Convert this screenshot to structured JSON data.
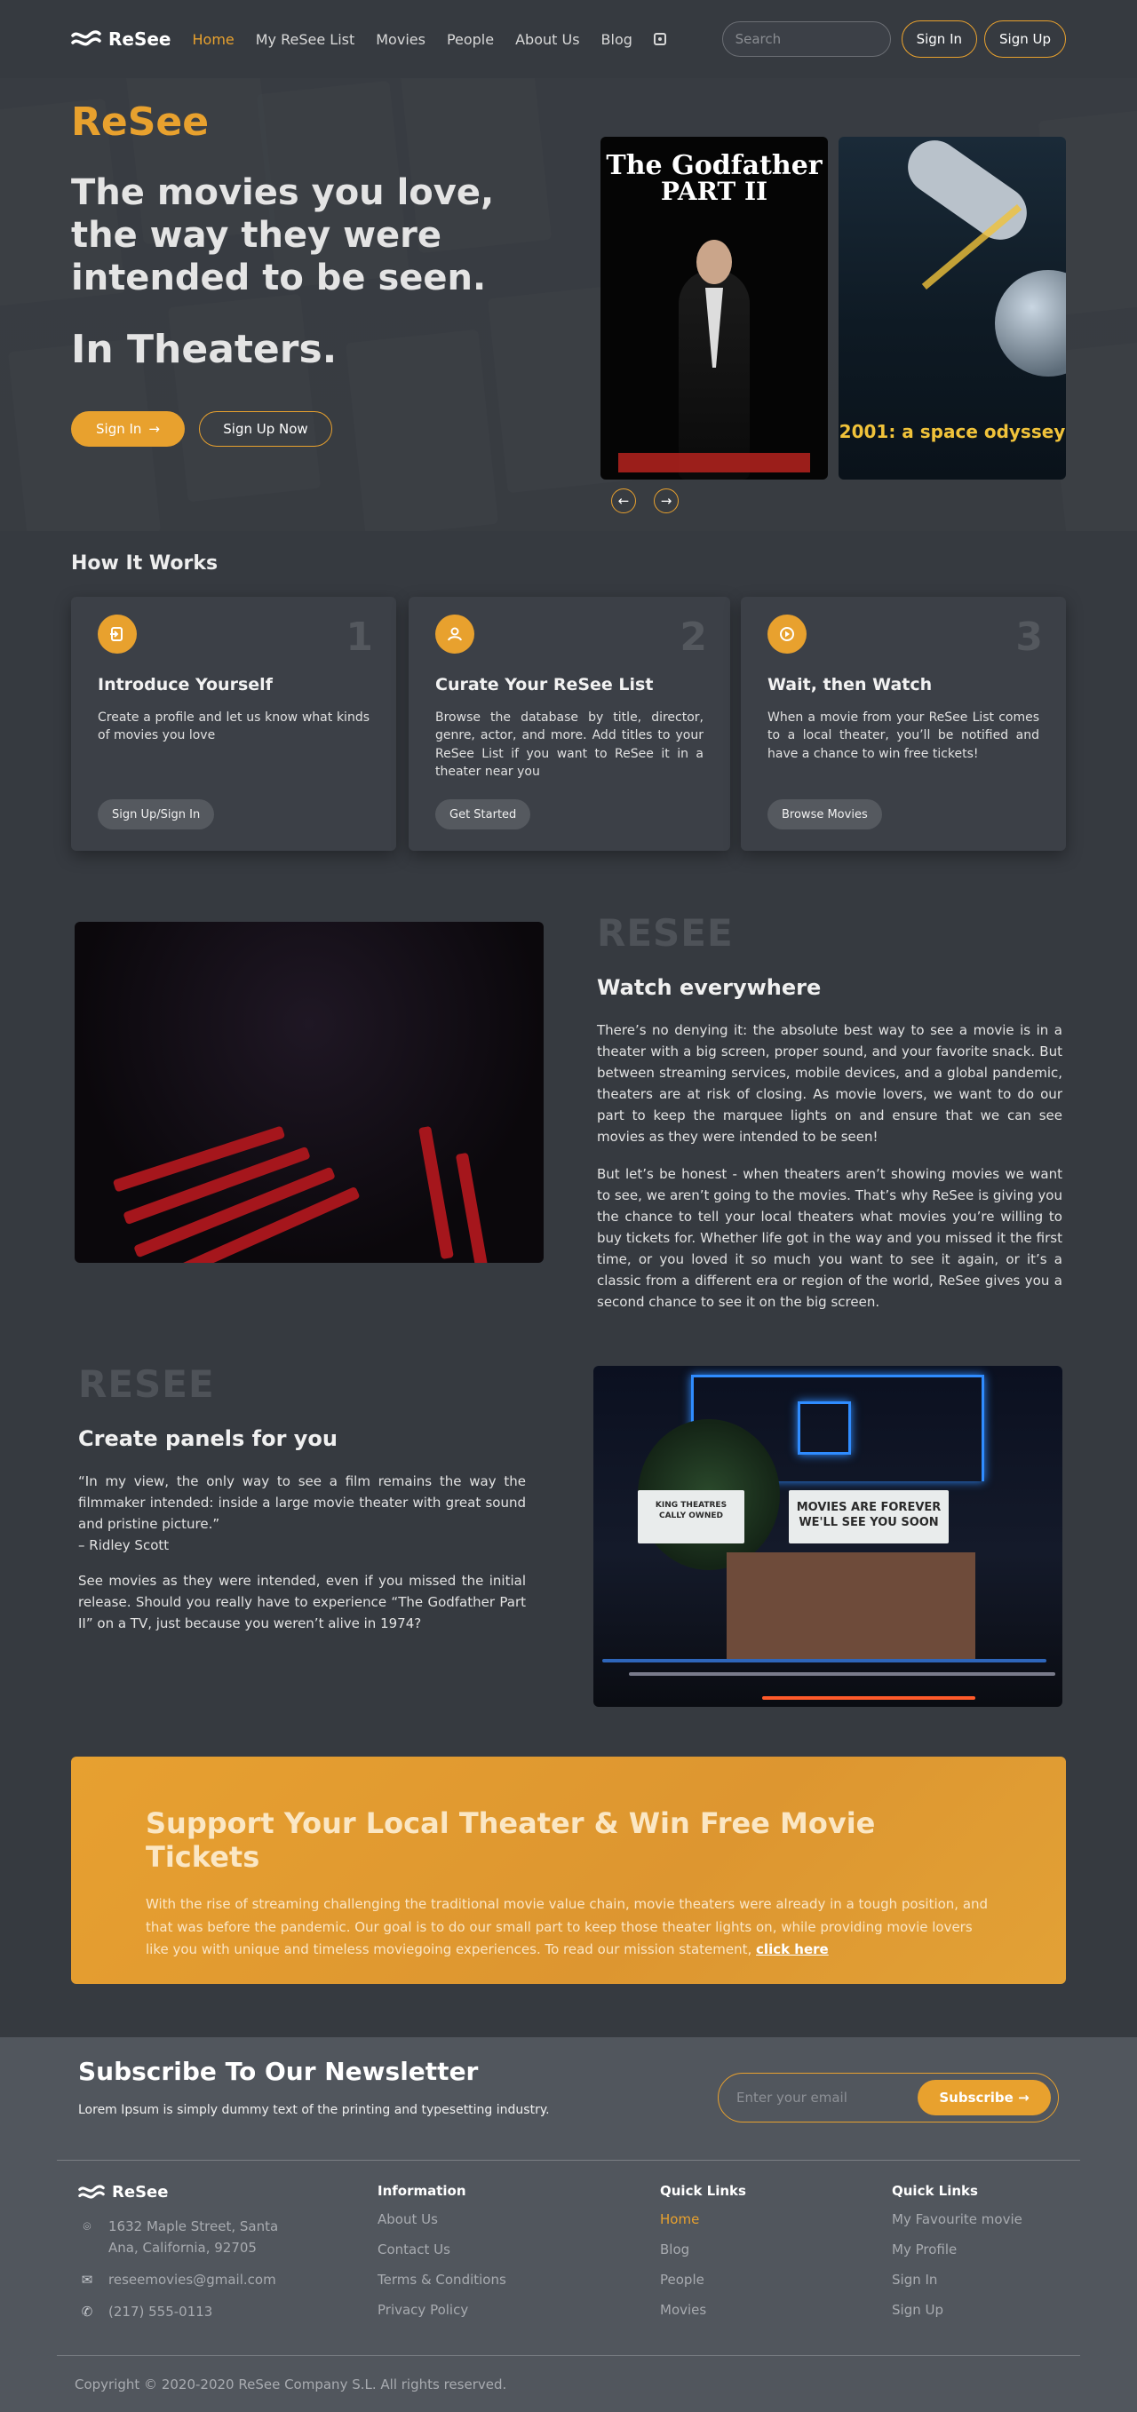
{
  "header": {
    "brand": "ReSee",
    "nav": [
      "Home",
      "My ReSee List",
      "Movies",
      "People",
      "About Us",
      "Blog"
    ],
    "search_placeholder": "Search",
    "sign_in": "Sign In",
    "sign_up": "Sign Up"
  },
  "hero": {
    "brand": "ReSee",
    "title": "The movies you love, the way they were intended to be seen.",
    "subtitle": "In Theaters.",
    "sign_in": "Sign In",
    "sign_up_now": "Sign Up Now",
    "poster1": {
      "title": "The Godfather",
      "subtitle": "PART II"
    },
    "poster2": {
      "title": "2001: a space odyssey"
    }
  },
  "how_it_works": {
    "title": "How It Works",
    "cards": [
      {
        "num": "1",
        "title": "Introduce Yourself",
        "text": "Create a profile and let us know what kinds of movies you love",
        "button": "Sign Up/Sign In"
      },
      {
        "num": "2",
        "title": "Curate Your ReSee List",
        "text": "Browse the database by title, director, genre, actor, and more. Add titles to your ReSee List if you want to ReSee it in a theater near you",
        "button": "Get Started"
      },
      {
        "num": "3",
        "title": "Wait, then Watch",
        "text": "When a movie from your ReSee List comes to a local theater, you’ll be notified and have a chance to win free tickets!",
        "button": "Browse Movies"
      }
    ]
  },
  "watch": {
    "watermark": "RESEE",
    "title": "Watch everywhere",
    "p1": "There’s no denying it: the absolute best way to see a movie is in a theater with a big screen, proper sound, and your favorite snack. But between streaming services, mobile devices, and a global pandemic, theaters are at risk of closing. As movie lovers, we want to do our part to keep the marquee lights on and ensure that we can see movies as they were intended to be seen!",
    "p2": "But let’s be honest - when theaters aren’t showing movies we want to see, we aren’t going to the movies. That’s why ReSee is giving you the chance to tell your local theaters what movies you’re willing to buy tickets for. Whether life got in the way and you missed it the first time, or you loved it so much you want to see it again, or it’s a classic from a different era or region of the world, ReSee gives you a second chance to see it on the big screen."
  },
  "panels": {
    "watermark": "RESEE",
    "title": "Create panels for you",
    "quote": "“In my view, the only way to see a film remains the way the filmmaker intended: inside a large movie theater with great sound and pristine picture.”",
    "author": "– Ridley Scott",
    "p2": "See movies as they were intended, even if you missed the initial release. Should you really have to experience “The Godfather Part II” on a TV, just because you weren’t alive in 1974?",
    "marquee_line1": "MOVIES ARE FOREVER",
    "marquee_line2": "WE'LL SEE YOU SOON",
    "side_line1": "KING THEATRES",
    "side_line2": "CALLY OWNED"
  },
  "banner": {
    "title": "Support Your Local Theater & Win Free Movie Tickets",
    "text": "With the rise of streaming challenging the traditional movie value chain, movie theaters were already in a tough position, and that was before the pandemic. Our goal is to do our small part to keep those theater lights on, while providing movie lovers like you with unique and timeless moviegoing experiences. To read our mission statement,",
    "link": "click here"
  },
  "newsletter": {
    "title": "Subscribe To Our Newsletter",
    "text": "Lorem Ipsum is simply dummy text of the printing and typesetting industry.",
    "placeholder": "Enter your email",
    "button": "Subscribe"
  },
  "footer": {
    "brand": "ReSee",
    "address": "1632 Maple Street, Santa Ana, California, 92705",
    "email": "reseemovies@gmail.com",
    "phone": "(217) 555-0113",
    "col1": {
      "title": "Information",
      "links": [
        "About Us",
        "Contact Us",
        "Terms & Conditions",
        "Privacy Policy"
      ]
    },
    "col2": {
      "title": "Quick Links",
      "links": [
        "Home",
        "Blog",
        "People",
        "Movies"
      ]
    },
    "col3": {
      "title": "Quick Links",
      "links": [
        "My Favourite movie",
        "My Profile",
        "Sign In",
        "Sign Up"
      ]
    },
    "copyright": "Copyright © 2020-2020 ReSee Company S.L. All rights reserved."
  },
  "colors": {
    "accent": "#e8a12e",
    "background": "#363a40",
    "footer": "#51565d"
  }
}
